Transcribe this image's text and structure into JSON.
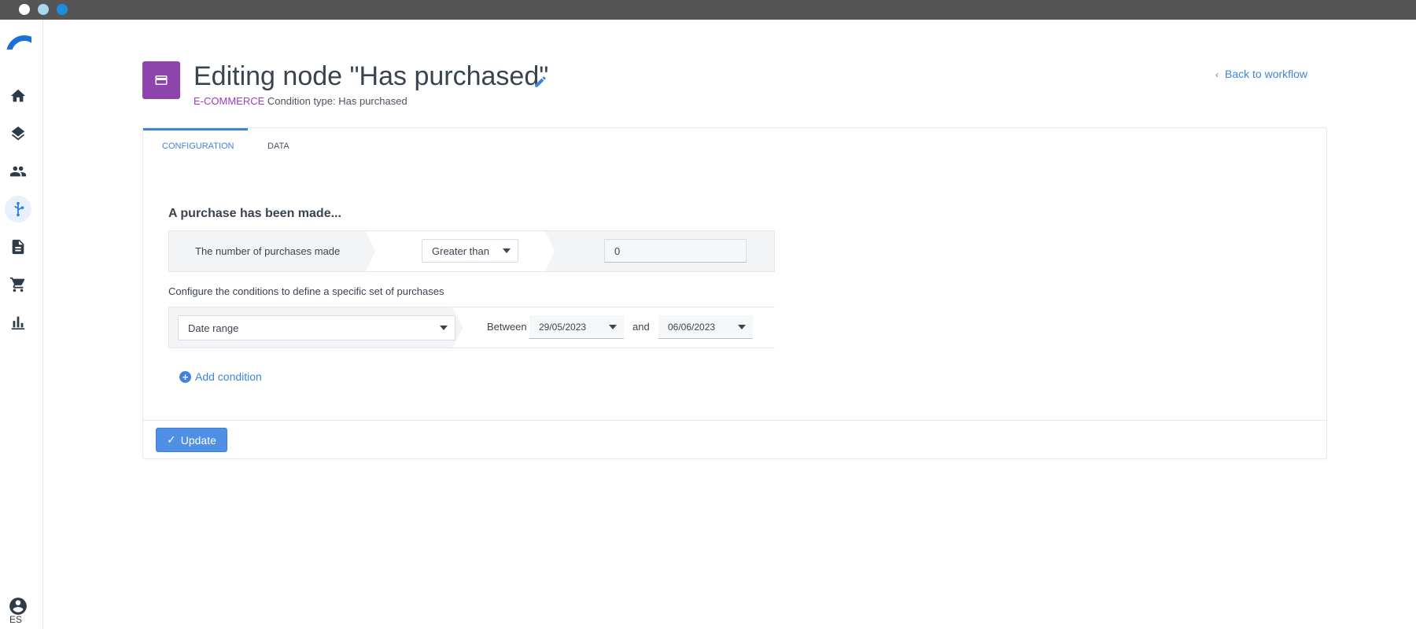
{
  "window": {
    "dots": [
      "#ffffff",
      "#a8d8f0",
      "#1a8fe0"
    ]
  },
  "sidebar": {
    "active": "workflows",
    "language": "ES"
  },
  "header": {
    "title": "Editing node \"Has purchased\"",
    "category": "E-COMMERCE",
    "condition_type": "Condition type: Has purchased",
    "back_link": "Back to workflow",
    "node_color": "#8e44ad"
  },
  "tabs": [
    {
      "label": "CONFIGURATION",
      "active": true
    },
    {
      "label": "DATA",
      "active": false
    }
  ],
  "form": {
    "section_title": "A purchase has been made...",
    "metric_label": "The number of purchases made",
    "operator": "Greater than",
    "value": "0",
    "hint": "Configure the conditions to define a specific set of purchases",
    "condition_field": "Date range",
    "between_label": "Between",
    "date_from": "29/05/2023",
    "and_label": "and",
    "date_to": "06/06/2023",
    "add_condition": "Add condition"
  },
  "footer": {
    "update_label": "Update"
  },
  "colors": {
    "accent": "#3f85d6",
    "category": "#9b3dbf"
  }
}
